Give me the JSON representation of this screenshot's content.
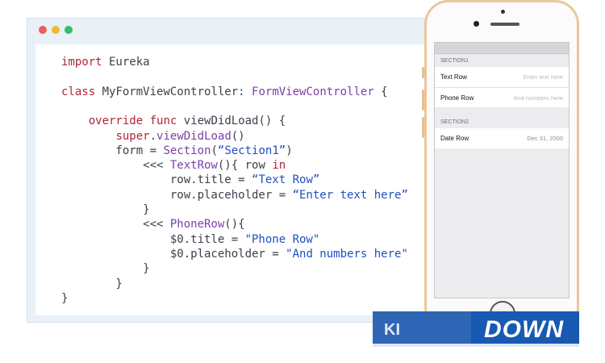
{
  "editor": {
    "lines": [
      [
        [
          "kw",
          "import"
        ],
        [
          "plain",
          " Eureka"
        ]
      ],
      [],
      [
        [
          "kw",
          "class"
        ],
        [
          "plain",
          " MyFormViewController: "
        ],
        [
          "type",
          "FormViewController"
        ],
        [
          "plain",
          " {"
        ]
      ],
      [],
      [
        [
          "plain",
          "    "
        ],
        [
          "kw",
          "override"
        ],
        [
          "plain",
          " "
        ],
        [
          "kw",
          "func"
        ],
        [
          "plain",
          " viewDidLoad() {"
        ]
      ],
      [
        [
          "plain",
          "        "
        ],
        [
          "kw",
          "super"
        ],
        [
          "plain",
          "."
        ],
        [
          "type",
          "viewDidLoad"
        ],
        [
          "plain",
          "()"
        ]
      ],
      [
        [
          "plain",
          "        form = "
        ],
        [
          "type",
          "Section"
        ],
        [
          "plain",
          "("
        ],
        [
          "str",
          "“Section1”"
        ],
        [
          "plain",
          ")"
        ]
      ],
      [
        [
          "plain",
          "            <<< "
        ],
        [
          "type",
          "TextRow"
        ],
        [
          "plain",
          "(){ row "
        ],
        [
          "kw",
          "in"
        ]
      ],
      [
        [
          "plain",
          "                row.title = "
        ],
        [
          "str",
          "“Text Row”"
        ]
      ],
      [
        [
          "plain",
          "                row.placeholder = "
        ],
        [
          "str",
          "“Enter text here”"
        ]
      ],
      [
        [
          "plain",
          "            }"
        ]
      ],
      [
        [
          "plain",
          "            <<< "
        ],
        [
          "type",
          "PhoneRow"
        ],
        [
          "plain",
          "(){"
        ]
      ],
      [
        [
          "plain",
          "                $0.title = "
        ],
        [
          "str",
          "\"Phone Row\""
        ]
      ],
      [
        [
          "plain",
          "                $0.placeholder = "
        ],
        [
          "str",
          "\"And numbers here\""
        ]
      ],
      [
        [
          "plain",
          "            }"
        ]
      ],
      [
        [
          "plain",
          "        }"
        ]
      ],
      [
        [
          "plain",
          "}"
        ]
      ]
    ]
  },
  "phone_form": {
    "section1_title": "SECTION1",
    "text_row_label": "Text Row",
    "text_row_placeholder": "Enter text here",
    "phone_row_label": "Phone Row",
    "phone_row_placeholder": "And numbers here",
    "section2_title": "SECTION2",
    "date_row_label": "Date Row",
    "date_row_value": "Dec 31, 2000"
  },
  "watermark": {
    "left_text": "KI",
    "right_text": "DOWN"
  },
  "colors": {
    "keyword": "#b0243b",
    "type": "#7a3fa8",
    "string": "#1f4fbf",
    "phone_frame": "#e9c79c",
    "banner": "#1859b2"
  }
}
